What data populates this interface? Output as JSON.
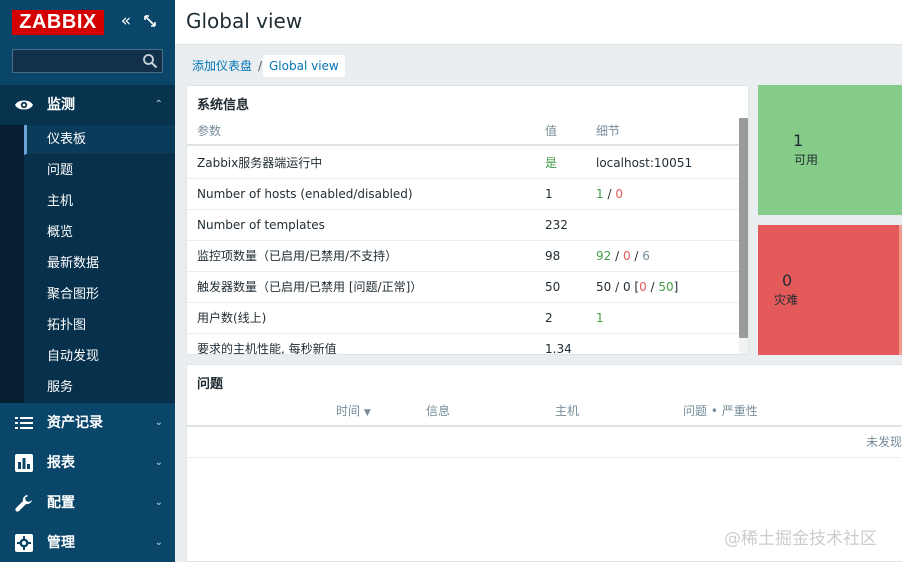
{
  "app": {
    "logo": "ZABBIX",
    "collapse_glyph": "«"
  },
  "search": {
    "value": "",
    "placeholder": ""
  },
  "nav": {
    "monitoring": {
      "label": "监测",
      "chevron": "⌃"
    },
    "submenu": [
      {
        "label": "仪表板",
        "active": true
      },
      {
        "label": "问题"
      },
      {
        "label": "主机"
      },
      {
        "label": "概览"
      },
      {
        "label": "最新数据"
      },
      {
        "label": "聚合图形"
      },
      {
        "label": "拓扑图"
      },
      {
        "label": "自动发现"
      },
      {
        "label": "服务"
      }
    ],
    "sections": [
      {
        "label": "资产记录",
        "chevron": "⌄"
      },
      {
        "label": "报表",
        "chevron": "⌄"
      },
      {
        "label": "配置",
        "chevron": "⌄"
      },
      {
        "label": "管理",
        "chevron": "⌄"
      }
    ]
  },
  "header": {
    "title": "Global view"
  },
  "breadcrumb": {
    "parent": "添加仪表盘",
    "separator": "/",
    "current": "Global view"
  },
  "sysinfo": {
    "title": "系统信息",
    "columns": [
      "参数",
      "值",
      "细节"
    ],
    "rows": [
      {
        "param": "Zabbix服务器端运行中",
        "value": "是",
        "detail_a": "localhost:10051"
      },
      {
        "param": "Number of hosts (enabled/disabled)",
        "value": "1",
        "detail_a": "1",
        "detail_sep1": " / ",
        "detail_b": "0"
      },
      {
        "param": "Number of templates",
        "value": "232"
      },
      {
        "param": "监控项数量（已启用/已禁用/不支持）",
        "value": "98",
        "detail_a": "92",
        "detail_sep1": " / ",
        "detail_b": "0",
        "detail_sep2": " / ",
        "detail_c": "6"
      },
      {
        "param": "触发器数量（已启用/已禁用 [问题/正常]）",
        "value": "50",
        "detail_a": "50 / 0 [",
        "detail_b": "0",
        "detail_sep1": " / ",
        "detail_c": "50",
        "detail_end": "]"
      },
      {
        "param": "用户数(线上)",
        "value": "2",
        "detail_a": "1"
      },
      {
        "param": "要求的主机性能, 每秒新值",
        "value": "1.34"
      }
    ]
  },
  "tiles": {
    "available": {
      "count": "1",
      "label": "可用"
    },
    "disaster": {
      "count": "0",
      "label": "灾难"
    }
  },
  "problems": {
    "title": "问题",
    "columns": {
      "time": "时间",
      "sort_arrow": "▼",
      "info": "信息",
      "host": "主机",
      "problem": "问题 • 严重性"
    },
    "no_data": "未发现"
  },
  "watermark": "@稀土掘金技术社区",
  "colors": {
    "sidebar": "#0a466a",
    "logo": "#d40000",
    "ok_green": "#86cc89",
    "disaster_red": "#e45959",
    "link": "#0275b8"
  }
}
